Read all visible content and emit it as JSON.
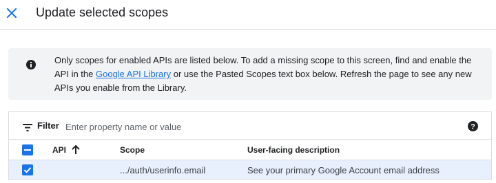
{
  "dialog": {
    "title": "Update selected scopes",
    "close_icon": "close-icon"
  },
  "banner": {
    "icon": "info-icon",
    "text_before_link": "Only scopes for enabled APIs are listed below. To add a missing scope to this screen, find and enable the API in the ",
    "link_text": "Google API Library",
    "text_after_link": " or use the Pasted Scopes text box below. Refresh the page to see any new APIs you enable from the Library."
  },
  "filter": {
    "icon": "filter-icon",
    "label": "Filter",
    "placeholder": "Enter property name or value",
    "value": "",
    "help_icon": "help-icon"
  },
  "table": {
    "columns": {
      "api": "API",
      "api_sort": "ascending",
      "scope": "Scope",
      "description": "User-facing description"
    },
    "header_checkbox_state": "indeterminate",
    "rows": [
      {
        "checked": true,
        "api": "",
        "scope": ".../auth/userinfo.email",
        "description": "See your primary Google Account email address"
      }
    ]
  },
  "colors": {
    "accent": "#1a73e8",
    "banner_bg": "#f1f3f4",
    "selected_row_bg": "#e8f0fe",
    "divider": "#dadce0"
  }
}
